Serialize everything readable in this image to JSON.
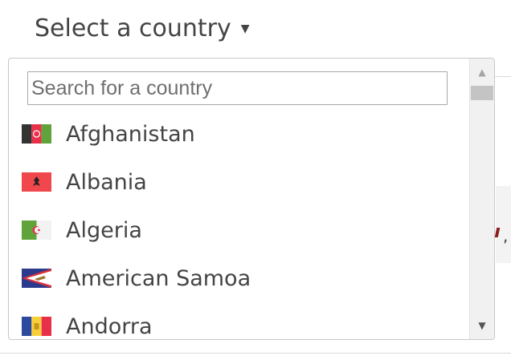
{
  "selector": {
    "label": "Select a country",
    "caret_icon": "caret-down-icon"
  },
  "dropdown": {
    "search": {
      "value": "",
      "placeholder": "Search for a country"
    },
    "countries": [
      {
        "name": "Afghanistan",
        "flag_icon": "afghanistan-flag-icon"
      },
      {
        "name": "Albania",
        "flag_icon": "albania-flag-icon"
      },
      {
        "name": "Algeria",
        "flag_icon": "algeria-flag-icon"
      },
      {
        "name": "American Samoa",
        "flag_icon": "american-samoa-flag-icon"
      },
      {
        "name": "Andorra",
        "flag_icon": "andorra-flag-icon"
      }
    ],
    "scrollbar": {
      "up_icon": "scroll-up-arrow-icon",
      "down_icon": "scroll-down-arrow-icon"
    }
  },
  "colors": {
    "text": "#444444",
    "border": "#c8c8c8",
    "scroll_track": "#f1f1f1",
    "scroll_thumb": "#c4c4c4"
  }
}
